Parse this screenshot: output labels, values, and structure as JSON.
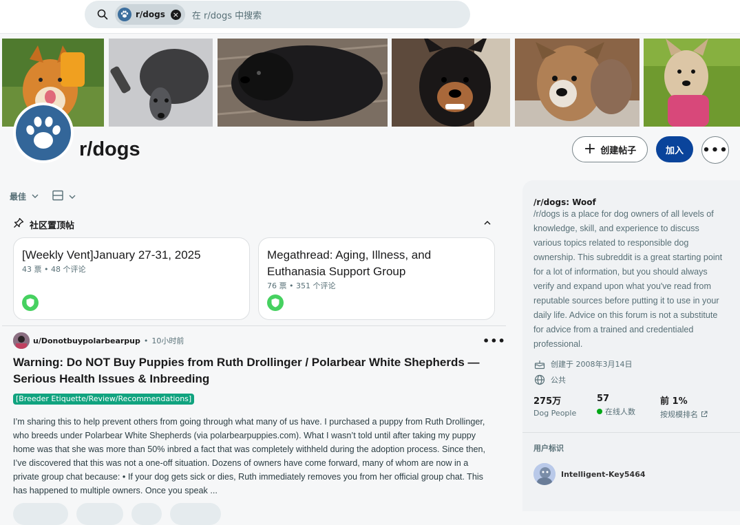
{
  "search": {
    "chip_label": "r/dogs",
    "placeholder": "在 r/dogs 中搜索",
    "icon": "search-icon"
  },
  "subreddit": {
    "name": "r/dogs",
    "create_post_label": "创建帖子",
    "join_label": "加入",
    "more_label": "•••"
  },
  "feed": {
    "sort_label": "最佳",
    "pinned_header": "社区置顶帖",
    "pinned": [
      {
        "title": "[Weekly Vent]January 27-31, 2025",
        "meta": "43 票 • 48 个评论"
      },
      {
        "title": "Megathread: Aging, Illness, and Euthanasia Support Group",
        "meta": "76 票 • 351 个评论"
      }
    ]
  },
  "post": {
    "user": "u/Donotbuypolarbearpup",
    "dot": "•",
    "time": "10小时前",
    "more": "•••",
    "title": "Warning: Do NOT Buy Puppies from Ruth Drollinger / Polarbear White Shepherds — Serious Health Issues & Inbreeding",
    "flair": "[Breeder Etiquette/Review/Recommendations]",
    "body": "I’m sharing this to help prevent others from going through what many of us have. I purchased a puppy from Ruth Drollinger, who breeds under Polarbear White Shepherds (via polarbearpuppies.com). What I wasn’t told until after taking my puppy home was that she was more than 50% inbred a fact that was completely withheld during the adoption process. Since then, I’ve discovered that this was not a one-off situation. Dozens of owners have come forward, many of whom are now in a private group chat because: • If your dog gets sick or dies, Ruth immediately removes you from her official group chat. This has happened to multiple owners. Once you speak ..."
  },
  "sidebar": {
    "title": "/r/dogs: Woof",
    "description": "/r/dogs is a place for dog owners of all levels of knowledge, skill, and experience to discuss various topics related to responsible dog ownership. This subreddit is a great starting point for a lot of information, but you should always verify and expand upon what you've read from reputable sources before putting it to use in your daily life. Advice on this forum is not a substitute for advice from a trained and credentialed professional.",
    "created": "创建于 2008年3月14日",
    "visibility": "公共",
    "stats": [
      {
        "value": "275万",
        "label": "Dog People"
      },
      {
        "value": "57",
        "label": "在线人数"
      },
      {
        "value": "前 1%",
        "label": "按规模排名"
      }
    ],
    "flair_header": "用户标识",
    "flair_user": "Intelligent-Key5464"
  },
  "colors": {
    "join_button": "#0a449b",
    "online": "#01a816",
    "flair": "#10a37f",
    "mod_shield": "#46d160",
    "community_icon": "#336699"
  }
}
